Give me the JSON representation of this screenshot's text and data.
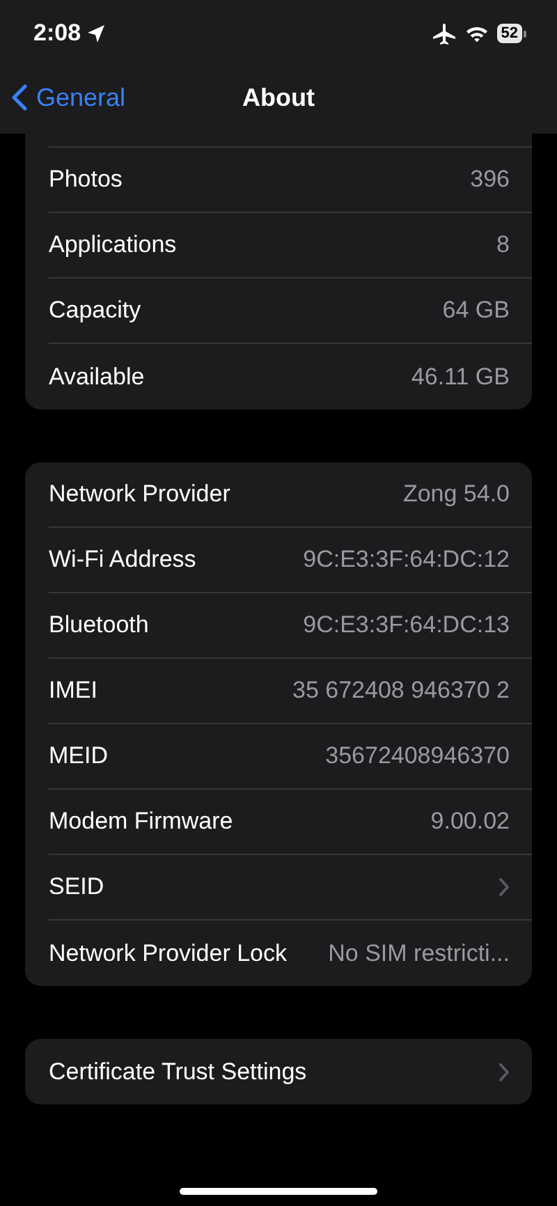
{
  "status_bar": {
    "time": "2:08",
    "battery": "52"
  },
  "nav": {
    "back": "General",
    "title": "About"
  },
  "groups": [
    {
      "cut_top": true,
      "rows": [
        {
          "kind": "value",
          "label": "Photos",
          "value": "396"
        },
        {
          "kind": "value",
          "label": "Applications",
          "value": "8"
        },
        {
          "kind": "value",
          "label": "Capacity",
          "value": "64 GB"
        },
        {
          "kind": "value",
          "label": "Available",
          "value": "46.11 GB"
        }
      ]
    },
    {
      "cut_top": false,
      "rows": [
        {
          "kind": "value",
          "label": "Network Provider",
          "value": "Zong 54.0"
        },
        {
          "kind": "value",
          "label": "Wi-Fi Address",
          "value": "9C:E3:3F:64:DC:12"
        },
        {
          "kind": "value",
          "label": "Bluetooth",
          "value": "9C:E3:3F:64:DC:13"
        },
        {
          "kind": "value",
          "label": "IMEI",
          "value": "35 672408 946370 2"
        },
        {
          "kind": "value",
          "label": "MEID",
          "value": "35672408946370"
        },
        {
          "kind": "value",
          "label": "Modem Firmware",
          "value": "9.00.02"
        },
        {
          "kind": "disclosure",
          "label": "SEID"
        },
        {
          "kind": "value",
          "label": "Network Provider Lock",
          "value": "No SIM restricti..."
        }
      ]
    },
    {
      "cut_top": false,
      "rows": [
        {
          "kind": "disclosure",
          "label": "Certificate Trust Settings"
        }
      ]
    }
  ]
}
